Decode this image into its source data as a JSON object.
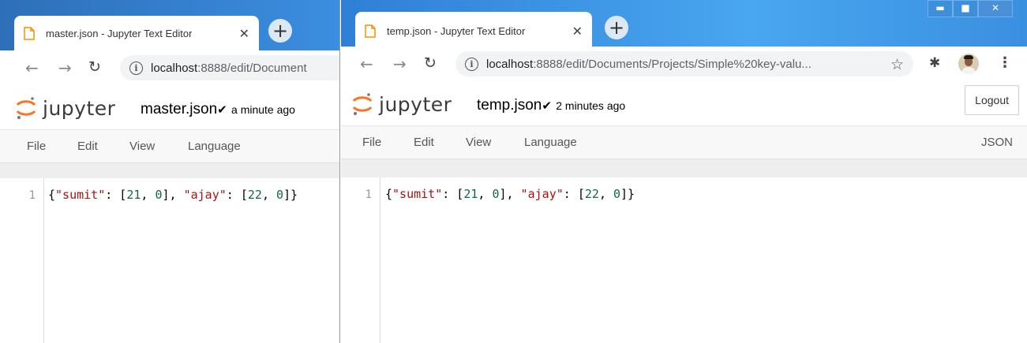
{
  "left_window": {
    "tab": {
      "title": "master.json - Jupyter Text Editor",
      "close": "✕"
    },
    "new_tab": "+",
    "address": {
      "host": "localhost",
      "path": ":8888/edit/Document"
    },
    "header": {
      "logo_text": "jupyter",
      "filename": "master.json",
      "saved_status": "a minute ago"
    },
    "menu": [
      "File",
      "Edit",
      "View",
      "Language"
    ],
    "editor": {
      "line_number": "1",
      "tokens": [
        "{",
        "\"sumit\"",
        ": [",
        "21",
        ", ",
        "0",
        "], ",
        "\"ajay\"",
        ": [",
        "22",
        ", ",
        "0",
        "]}"
      ]
    }
  },
  "right_window": {
    "tab": {
      "title": "temp.json - Jupyter Text Editor",
      "close": "✕"
    },
    "new_tab": "+",
    "window_controls": {
      "minimize": "▬",
      "maximize": "■",
      "close": "✕"
    },
    "address": {
      "host": "localhost",
      "path": ":8888/edit/Documents/Projects/Simple%20key-valu..."
    },
    "header": {
      "logo_text": "jupyter",
      "filename": "temp.json",
      "saved_status": "2 minutes ago",
      "logout_label": "Logout"
    },
    "menu": [
      "File",
      "Edit",
      "View",
      "Language"
    ],
    "mode_label": "JSON",
    "editor": {
      "line_number": "1",
      "tokens": [
        "{",
        "\"sumit\"",
        ": [",
        "21",
        ", ",
        "0",
        "], ",
        "\"ajay\"",
        ": [",
        "22",
        ", ",
        "0",
        "]}"
      ]
    }
  },
  "colors": {
    "titlebar": "#2d8ae0",
    "string_token": "#aa1111",
    "number_token": "#116644",
    "jupyter_orange": "#f37726"
  },
  "icons": [
    "document-icon",
    "back-arrow-icon",
    "forward-arrow-icon",
    "reload-icon",
    "info-icon",
    "star-icon",
    "extensions-icon",
    "profile-avatar",
    "kebab-menu-icon",
    "checkmark-icon",
    "jupyter-logo"
  ]
}
